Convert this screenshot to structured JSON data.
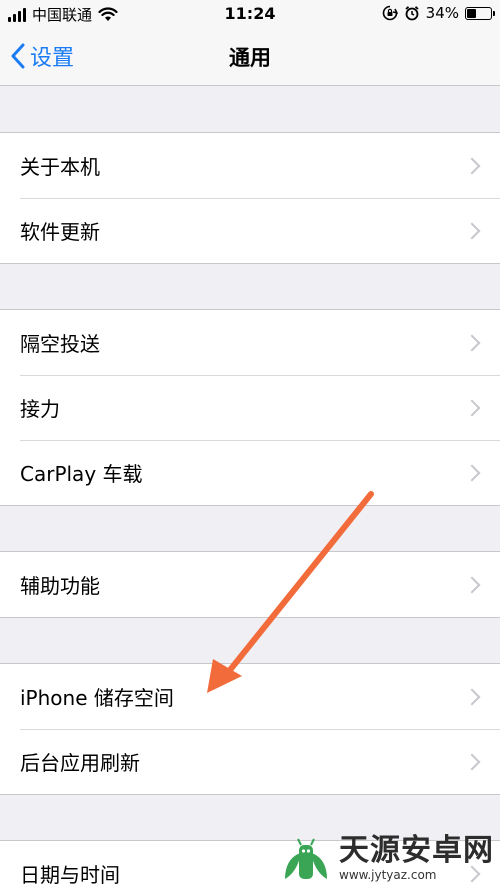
{
  "status_bar": {
    "carrier": "中国联通",
    "time": "11:24",
    "battery": "34%",
    "battery_level": 0.34
  },
  "nav": {
    "back_label": "设置",
    "title": "通用"
  },
  "groups": [
    {
      "items": [
        {
          "label": "关于本机"
        },
        {
          "label": "软件更新"
        }
      ]
    },
    {
      "items": [
        {
          "label": "隔空投送"
        },
        {
          "label": "接力"
        },
        {
          "label": "CarPlay 车载"
        }
      ]
    },
    {
      "items": [
        {
          "label": "辅助功能"
        }
      ]
    },
    {
      "items": [
        {
          "label": "iPhone 储存空间"
        },
        {
          "label": "后台应用刷新"
        }
      ]
    },
    {
      "items": [
        {
          "label": "日期与时间"
        }
      ]
    }
  ],
  "annotation": {
    "arrow_color": "#f26b3a"
  },
  "watermark": {
    "title": "天源安卓网",
    "url": "www.jytyaz.com",
    "logo_color": "#3aa655"
  },
  "colors": {
    "accent": "#1a7cf5",
    "background": "#efeff4"
  }
}
